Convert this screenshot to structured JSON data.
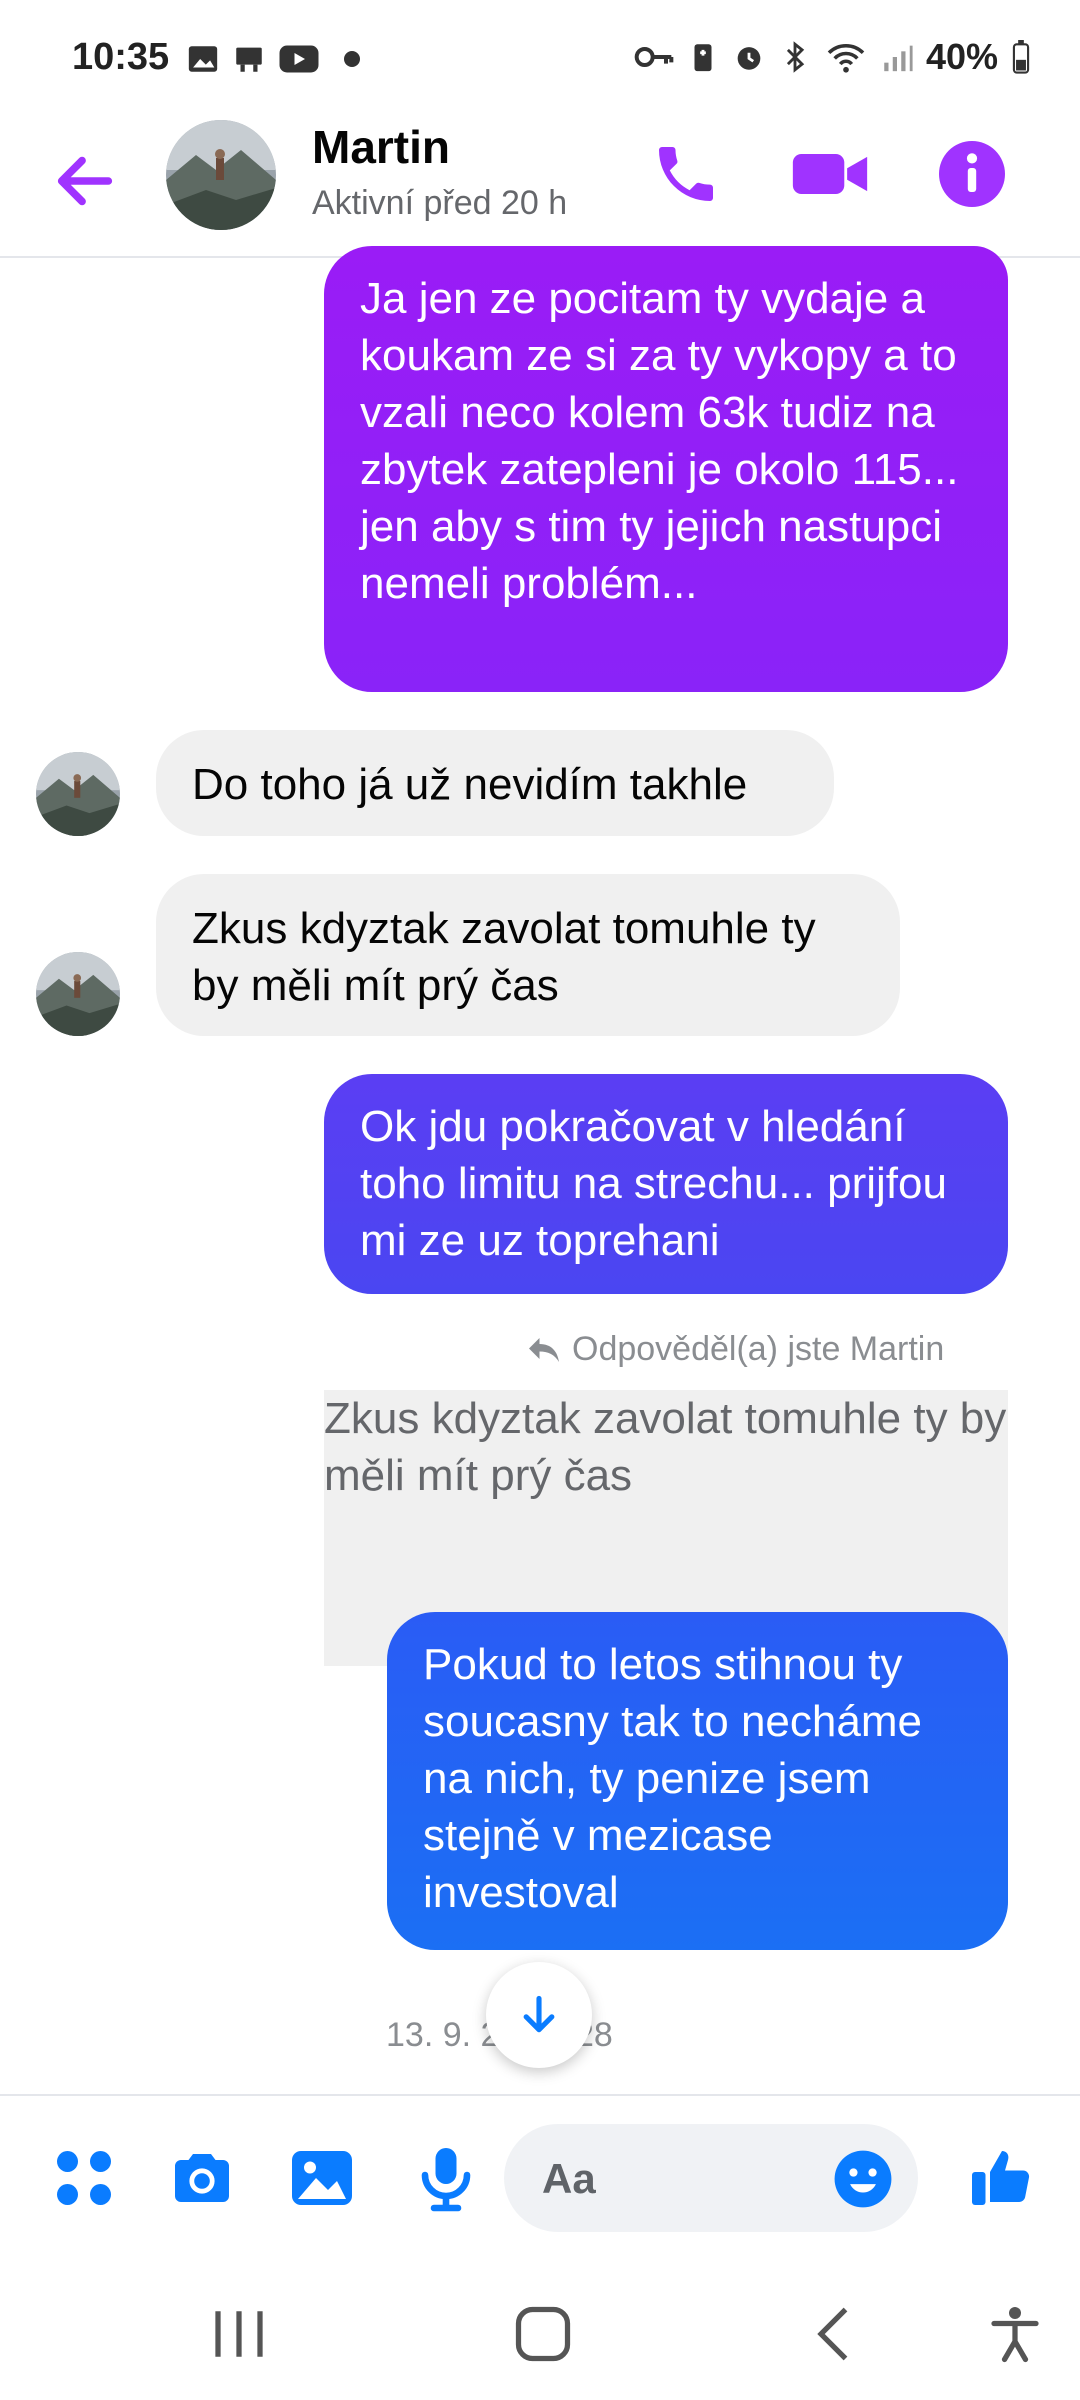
{
  "status_bar": {
    "time": "10:35",
    "battery": "40%",
    "left_icons": [
      "gallery-icon",
      "desk-icon",
      "youtube-icon",
      "dot-icon"
    ],
    "right_icons": [
      "key-icon",
      "battery-saver-icon",
      "alarm-icon",
      "bluetooth-icon",
      "wifi-icon",
      "signal-icon",
      "battery-icon"
    ]
  },
  "header": {
    "name": "Martin",
    "status": "Aktivní před 20 h",
    "accent": "#a033ff"
  },
  "messages": [
    {
      "side": "out",
      "text": "Ja jen ze pocitam ty vydaje a koukam ze si za ty vykopy a to vzali neco kolem 63k tudiz na zbytek zatepleni je okolo 115... jen aby s tim ty jejich nastupci nemeli problém..."
    },
    {
      "side": "in",
      "text": "Do toho já už nevidím takhle"
    },
    {
      "side": "in",
      "text": "Zkus kdyztak zavolat tomuhle ty by měli mít prý čas"
    },
    {
      "side": "out",
      "text": "Ok jdu pokračovat v hledání toho limitu na strechu... prijfou mi ze uz toprehani"
    },
    {
      "side": "reply-quote",
      "text": "Zkus kdyztak zavolat tomuhle ty by měli mít prý čas"
    },
    {
      "side": "out",
      "text": "Pokud to letos stihnou ty soucasny tak to necháme na nich, ty penize jsem stejně v mezicase investoval"
    }
  ],
  "reply_label": "Odpověděl(a) jste Martin",
  "timestamp": "13. 9. 2   / 10:28",
  "composer": {
    "placeholder": "Aa"
  },
  "colors": {
    "purple": "#9a1cf6",
    "indigo": "#5b3ef3",
    "blue": "#1b6ff4",
    "icon_blue": "#0a7cff"
  }
}
